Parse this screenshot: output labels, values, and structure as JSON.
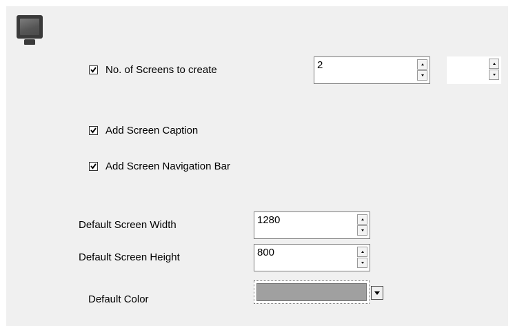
{
  "icon": "monitor-icon",
  "screens": {
    "checkbox_checked": true,
    "label": "No. of Screens to create",
    "count_value": "2",
    "second_value": ""
  },
  "options": {
    "caption_checked": true,
    "caption_label": "Add Screen Caption",
    "navbar_checked": true,
    "navbar_label": "Add Screen Navigation Bar"
  },
  "dimensions": {
    "width_label": "Default Screen Width",
    "width_value": "1280",
    "height_label": "Default Screen Height",
    "height_value": "800"
  },
  "color": {
    "label": "Default Color",
    "value": "#a0a0a0"
  }
}
